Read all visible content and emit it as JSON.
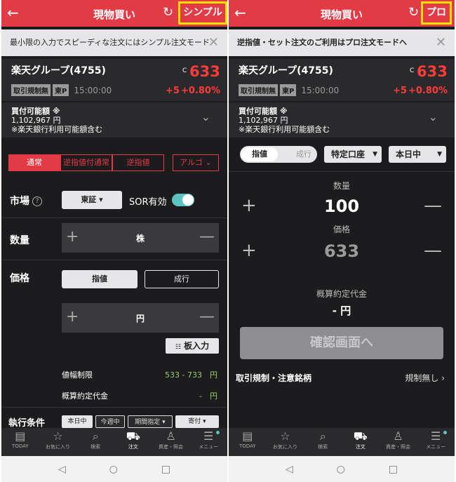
{
  "colors": {
    "accent": "#e23b45",
    "highlight": "#ffe000",
    "up": "#ff3c3c",
    "toggle": "#5cc3c0",
    "range_text": "#9ccc65"
  },
  "left": {
    "header": {
      "back_icon": "←",
      "title": "現物買い",
      "refresh_icon": "↻",
      "mode_label": "シンプル"
    },
    "notice": {
      "text": "最小限の入力でスピーディな注文にはシンプル注文モード",
      "close_icon": "✕"
    },
    "stock": {
      "name": "楽天グループ(4755)",
      "c_label": "C",
      "price": "633",
      "tags": [
        "取引規制無",
        "東P"
      ],
      "time": "15:00:00",
      "change": "+5",
      "change_pct": "+0.80%"
    },
    "buying": {
      "label": "買付可能額",
      "mark": "※",
      "amount": "1,102,967 円",
      "note": "※楽天銀行利用可能額含む",
      "chevron_icon": "⌄"
    },
    "order_types": [
      "通常",
      "逆指値付通常",
      "逆指値"
    ],
    "algo_label": "アルゴ",
    "market": {
      "label": "市場",
      "help_icon": "?",
      "exchange": "東証",
      "sor_label": "SOR有効",
      "sor_on": true
    },
    "quantity": {
      "label": "数量",
      "unit": "株",
      "plus": "+",
      "minus": "—"
    },
    "price": {
      "label": "価格",
      "limit_label": "指値",
      "market_label": "成行",
      "unit": "円",
      "plus": "+",
      "minus": "—"
    },
    "board_button": "板入力",
    "limit_range": {
      "label": "値幅制限",
      "value": "533 - 733　円"
    },
    "estimated": {
      "label": "概算約定代金",
      "value": "-　円"
    },
    "exec_cond": {
      "label": "執行条件",
      "chips": [
        "本日中",
        "今週中",
        "期間指定 ▾",
        "寄付 ▾"
      ]
    }
  },
  "right": {
    "header": {
      "back_icon": "←",
      "title": "現物買い",
      "refresh_icon": "↻",
      "mode_label": "プロ"
    },
    "notice": {
      "text": "逆指値・セット注文のご利用はプロ注文モードへ",
      "close_icon": "✕"
    },
    "stock": {
      "name": "楽天グループ(4755)",
      "c_label": "C",
      "price": "633",
      "tags": [
        "取引規制無",
        "東P"
      ],
      "time": "15:00:00",
      "change": "+5",
      "change_pct": "+0.80%"
    },
    "buying": {
      "label": "買付可能額",
      "mark": "※",
      "amount": "1,102,967 円",
      "note": "※楽天銀行利用可能額含む",
      "chevron_icon": "⌄"
    },
    "toggle": {
      "on_label": "指値",
      "off_label": "成行"
    },
    "account_select": "特定口座",
    "period_select": "本日中",
    "quantity": {
      "label": "数量",
      "value": "100"
    },
    "price": {
      "label": "価格",
      "value": "633"
    },
    "estimated": {
      "label": "概算約定代金",
      "value": "- 円"
    },
    "confirm": "確認画面へ",
    "regulation": {
      "label": "取引規制・注意銘柄",
      "value": "規制無し ›"
    }
  },
  "nav": [
    {
      "icon": "today-icon",
      "glyph": "▤",
      "label": "TODAY"
    },
    {
      "icon": "star-icon",
      "glyph": "☆",
      "label": "お気に入り"
    },
    {
      "icon": "search-icon",
      "glyph": "⌕",
      "label": "検索"
    },
    {
      "icon": "order-icon",
      "glyph": "⛟",
      "label": "注文"
    },
    {
      "icon": "person-icon",
      "glyph": "♙",
      "label": "資産・照会"
    },
    {
      "icon": "menu-icon",
      "glyph": "☰",
      "label": "メニュー"
    }
  ],
  "system_nav": {
    "back": "◁",
    "home": "○",
    "recent": "□"
  }
}
